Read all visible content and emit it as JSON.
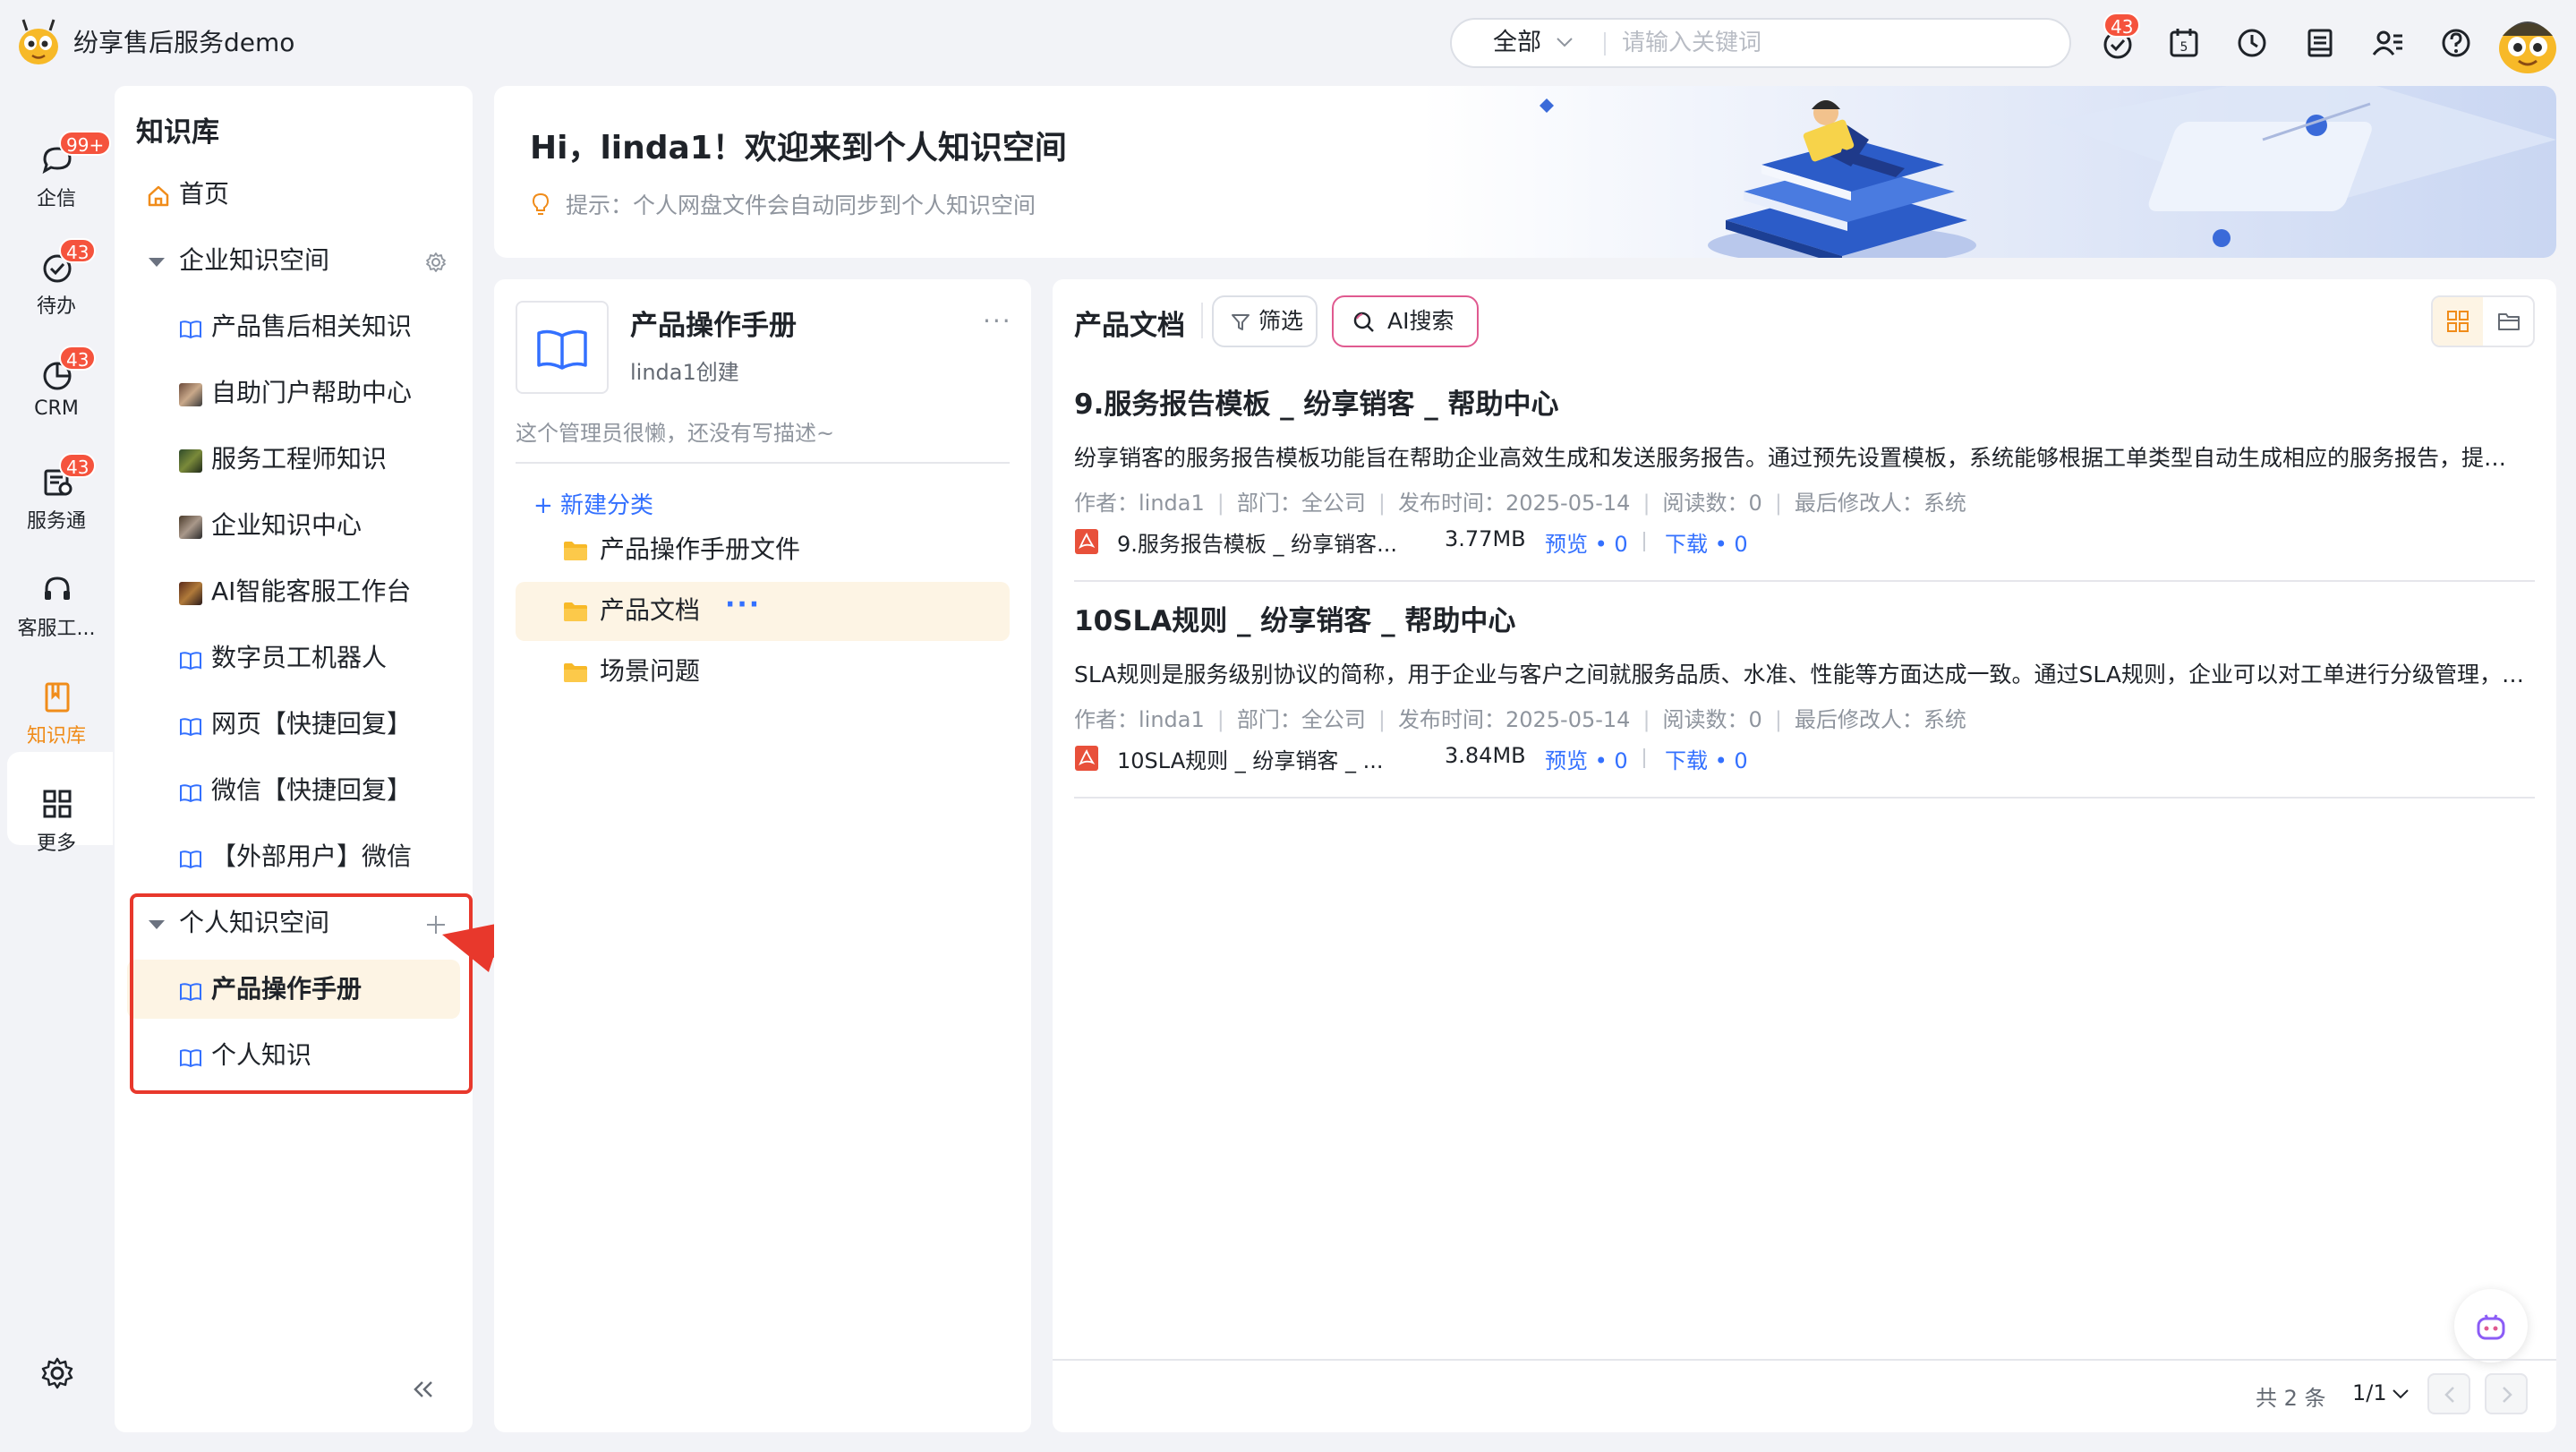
{
  "app": {
    "title": "纷享售后服务demo"
  },
  "search": {
    "scope": "全部",
    "placeholder": "请输入关键词"
  },
  "topbar": {
    "notification_badge": "43",
    "icons": [
      "notification-icon",
      "calendar-icon",
      "clock-icon",
      "notes-icon",
      "contacts-icon",
      "help-icon"
    ]
  },
  "rail": {
    "items": [
      {
        "label": "企信",
        "badge": "99+",
        "icon": "chat-icon"
      },
      {
        "label": "待办",
        "badge": "43",
        "icon": "todo-icon"
      },
      {
        "label": "CRM",
        "badge": "43",
        "icon": "crm-icon"
      },
      {
        "label": "服务通",
        "badge": "43",
        "icon": "service-icon"
      },
      {
        "label": "客服工...",
        "badge": "",
        "icon": "headset-icon"
      },
      {
        "label": "知识库",
        "badge": "",
        "icon": "knowledge-icon"
      },
      {
        "label": "更多",
        "badge": "",
        "icon": "grid-icon"
      }
    ],
    "active": "知识库"
  },
  "tree": {
    "title": "知识库",
    "home": "首页",
    "enterprise_space": "企业知识空间",
    "enterprise_items": [
      "产品售后相关知识",
      "自助门户帮助中心",
      "服务工程师知识",
      "企业知识中心",
      "AI智能客服工作台",
      "数字员工机器人",
      "网页【快捷回复】",
      "微信【快捷回复】",
      "【外部用户】微信"
    ],
    "personal_space": "个人知识空间",
    "personal_items": [
      "产品操作手册",
      "个人知识"
    ]
  },
  "banner": {
    "greeting": "Hi，linda1！欢迎来到个人知识空间",
    "tip": "提示：个人网盘文件会自动同步到个人知识空间"
  },
  "book": {
    "title": "产品操作手册",
    "creator": "linda1创建",
    "more": "···",
    "description": "这个管理员很懒，还没有写描述~",
    "new_category": "+ 新建分类",
    "categories": [
      "产品操作手册文件",
      "产品文档",
      "场景问题"
    ],
    "active_category": "产品文档",
    "category_more": "···"
  },
  "docs": {
    "title": "产品文档",
    "filter_label": "筛选",
    "ai_search_label": "AI搜索",
    "items": [
      {
        "title": "9.服务报告模板 _ 纷享销客 _ 帮助中心",
        "summary": "纷享销客的服务报告模板功能旨在帮助企业高效生成和发送服务报告。通过预先设置模板，系统能够根据工单类型自动生成相应的服务报告，提高服务效率和客户满意度。",
        "author": "作者：linda1",
        "dept": "部门：全公司",
        "published": "发布时间：2025-05-14",
        "reads": "阅读数：0",
        "modifier": "最后修改人：系统",
        "file_name": "9.服务报告模板 _ 纷享销客...",
        "file_size": "3.77MB",
        "preview": "预览 • 0",
        "download": "下载 • 0"
      },
      {
        "title": "10SLA规则 _ 纷享销客 _ 帮助中心",
        "summary": "SLA规则是服务级别协议的简称，用于企业与客户之间就服务品质、水准、性能等方面达成一致。通过SLA规则，企业可以对工单进行分级管理，确保服务及时响应。",
        "author": "作者：linda1",
        "dept": "部门：全公司",
        "published": "发布时间：2025-05-14",
        "reads": "阅读数：0",
        "modifier": "最后修改人：系统",
        "file_name": "10SLA规则 _ 纷享销客 _ ...",
        "file_size": "3.84MB",
        "preview": "预览 • 0",
        "download": "下载 • 0"
      }
    ],
    "total": "共 2 条",
    "page": "1/1"
  },
  "colors": {
    "accent": "#3370ff",
    "highlight": "#e8382c",
    "badge": "#f5533d",
    "selected_bg": "#fdf4e4",
    "ai_border": "#e05a90"
  }
}
